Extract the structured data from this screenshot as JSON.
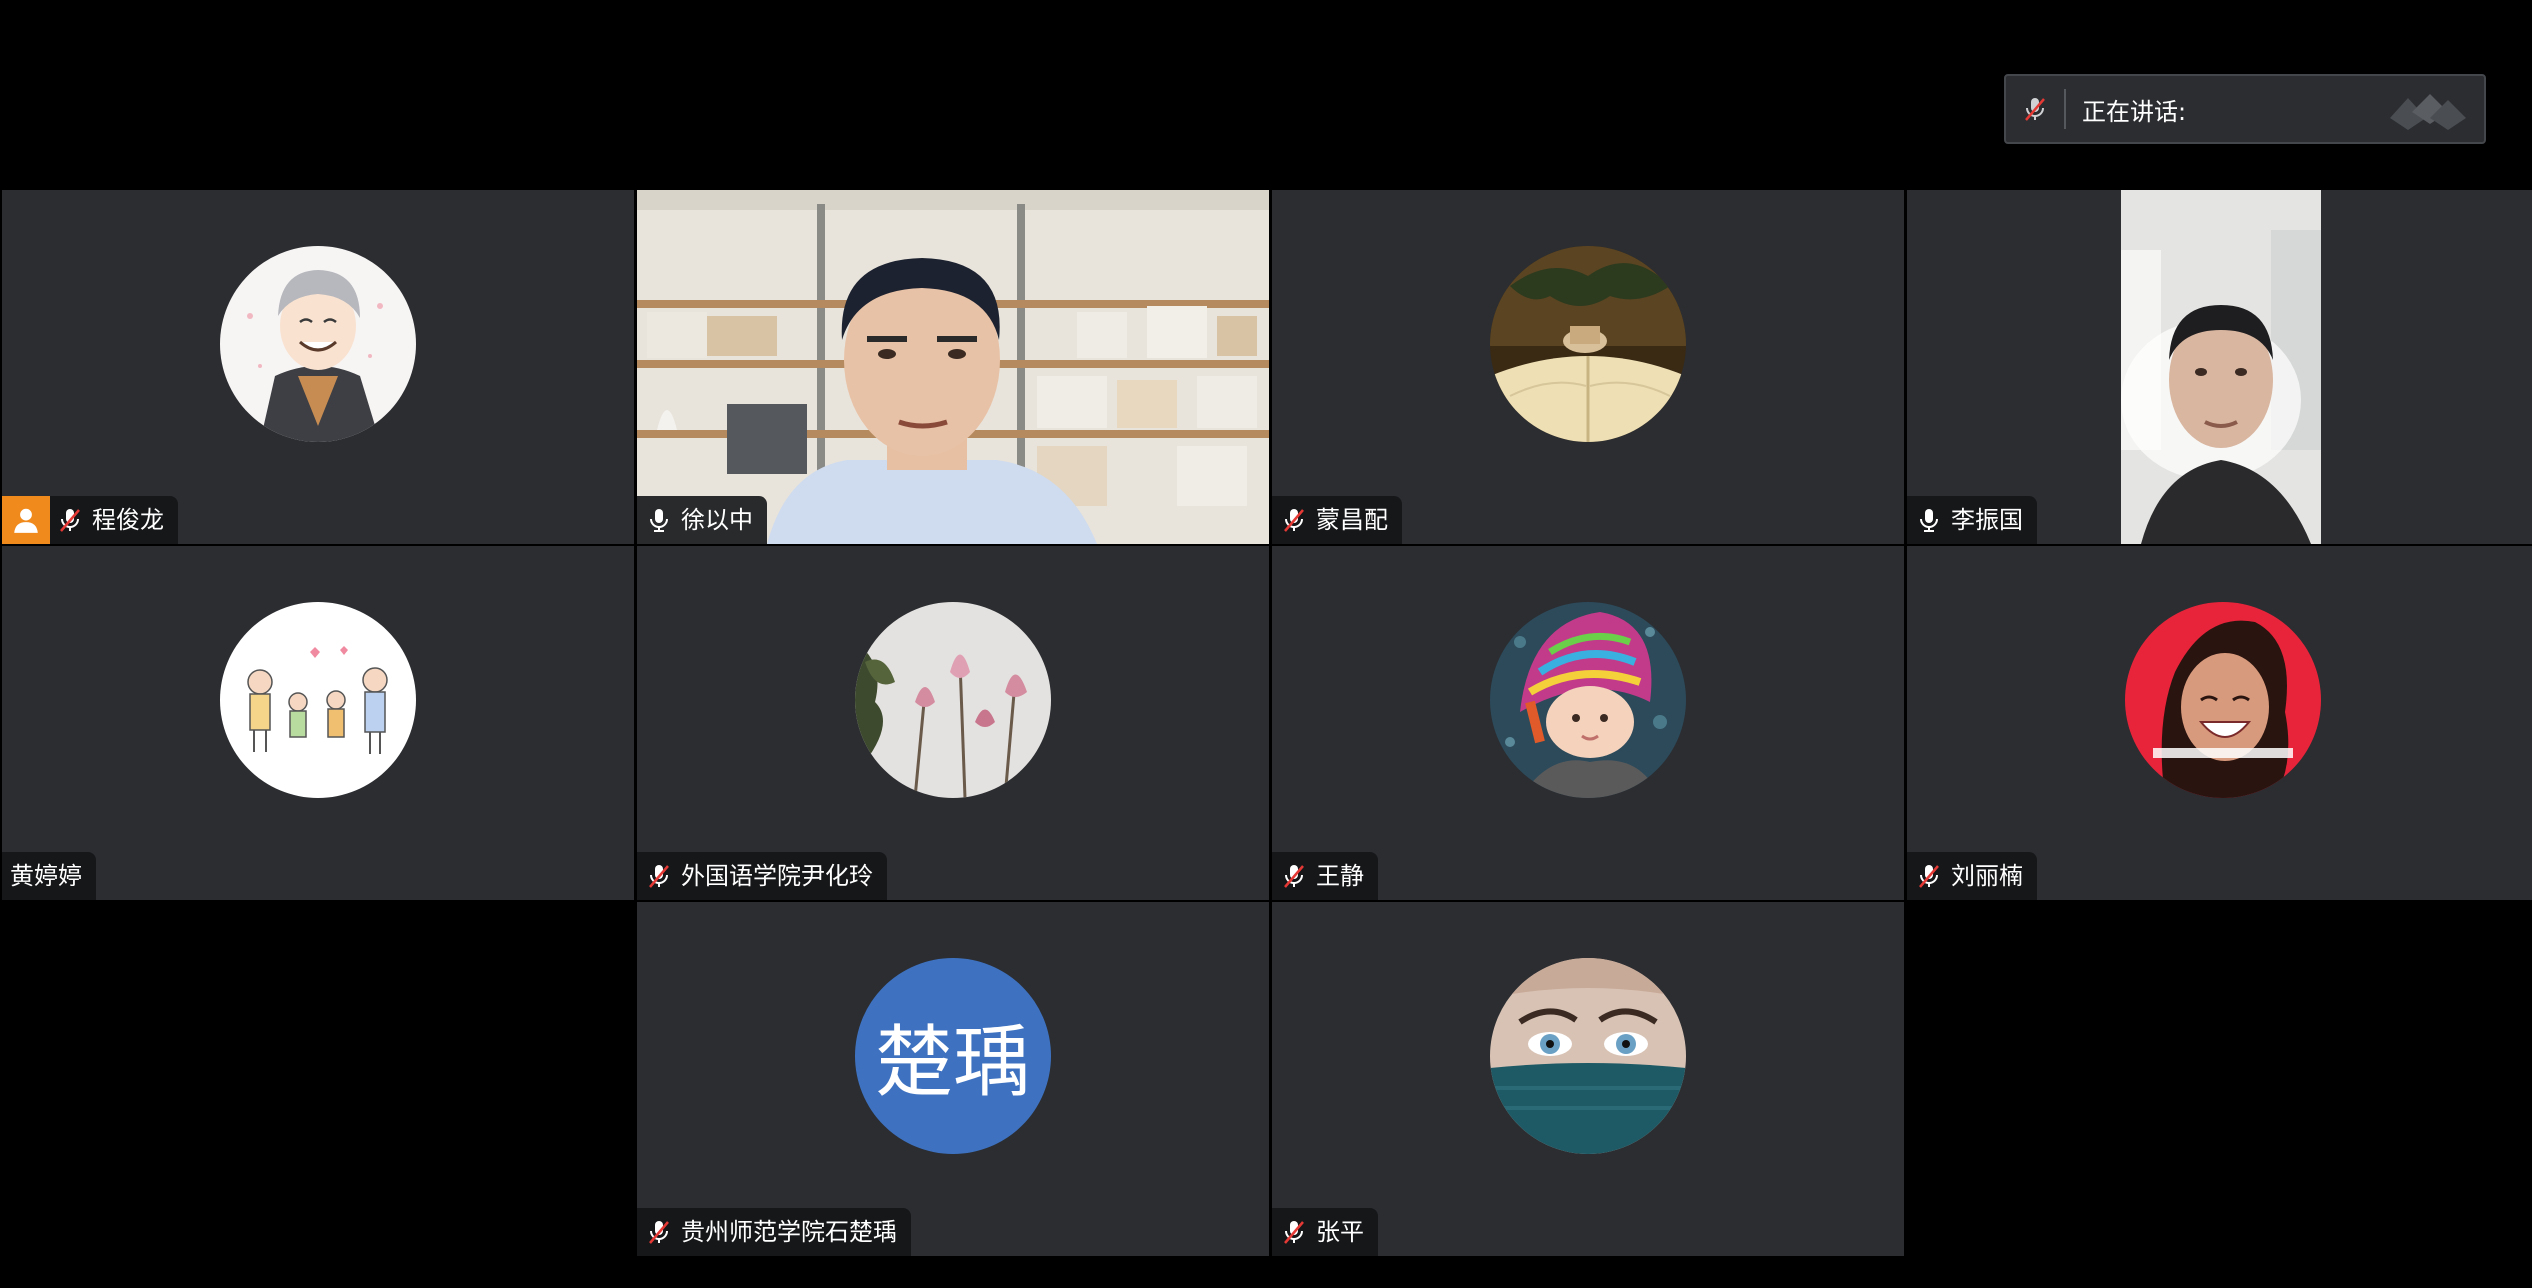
{
  "speaking": {
    "label": "正在讲话:"
  },
  "participants": [
    {
      "name": "程俊龙",
      "mic": "muted",
      "host": true
    },
    {
      "name": "徐以中",
      "mic": "on"
    },
    {
      "name": "蒙昌配",
      "mic": "muted"
    },
    {
      "name": "李振国",
      "mic": "on"
    },
    {
      "name": "黄婷婷",
      "mic": "none"
    },
    {
      "name": "外国语学院尹化玲",
      "mic": "muted"
    },
    {
      "name": "王静",
      "mic": "muted"
    },
    {
      "name": "刘丽楠",
      "mic": "muted"
    },
    {
      "name": "贵州师范学院石楚瑀",
      "mic": "muted",
      "initials": "楚瑀"
    },
    {
      "name": "张平",
      "mic": "muted"
    }
  ],
  "colors": {
    "tile_bg": "#2b2d31",
    "host_badge": "#f08a1c",
    "initials_avatar": "#3e72c0",
    "muted_slash": "#e53935"
  }
}
